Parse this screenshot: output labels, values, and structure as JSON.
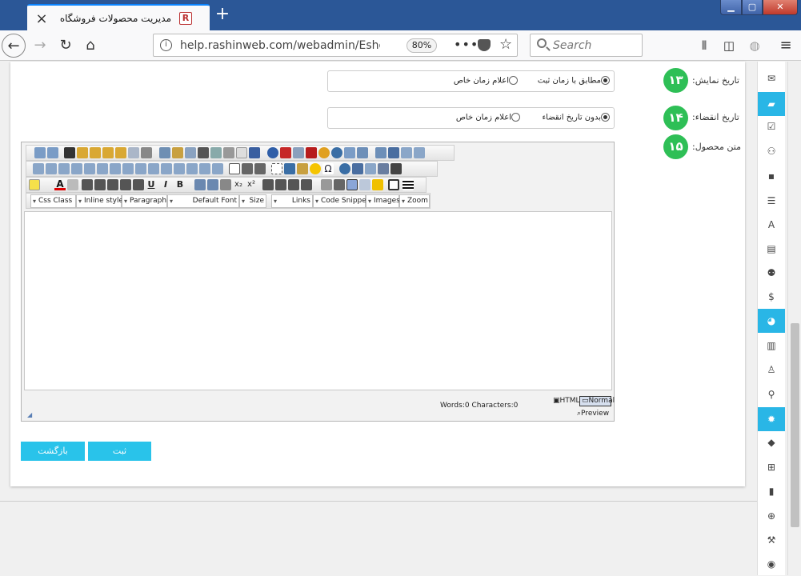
{
  "browser": {
    "tab_title": "مدیریت محصولات فروشگاه",
    "url": "help.rashinweb.com/webadmin/Eshop_Pr",
    "zoom": "80%",
    "search_placeholder": "Search",
    "new_tab": "+",
    "tab_close": "×"
  },
  "form": {
    "display_date": {
      "badge": "۱۳",
      "label": "تاریخ نمایش:",
      "option_1": "مطابق با زمان ثبت",
      "option_2": "اعلام زمان خاص",
      "selected": "option_1"
    },
    "expire_date": {
      "badge": "۱۴",
      "label": "تاریخ انقضاء:",
      "option_1": "بدون تاریخ انقضاء",
      "option_2": "اعلام زمان خاص",
      "selected": "option_1"
    },
    "product_text": {
      "badge": "۱۵",
      "label": "متن محصول:"
    }
  },
  "editor": {
    "dropdowns": {
      "css_class": "Css Class",
      "inline_style": "Inline style",
      "paragraph": "Paragraph",
      "font": "Default Font",
      "size": "Size",
      "links": "Links",
      "code_snippet": "Code Snippet",
      "images": "Images",
      "zoom": "Zoom"
    },
    "word_count": "Words:0 Characters:0",
    "mode_html": "HTML",
    "mode_normal": "Normal",
    "mode_preview": "Preview"
  },
  "buttons": {
    "back": "بازگشت",
    "submit": "ثبت"
  },
  "colors": {
    "accent": "#29c3ea",
    "badge": "#2ebf56",
    "titlebar": "#2b5797"
  }
}
